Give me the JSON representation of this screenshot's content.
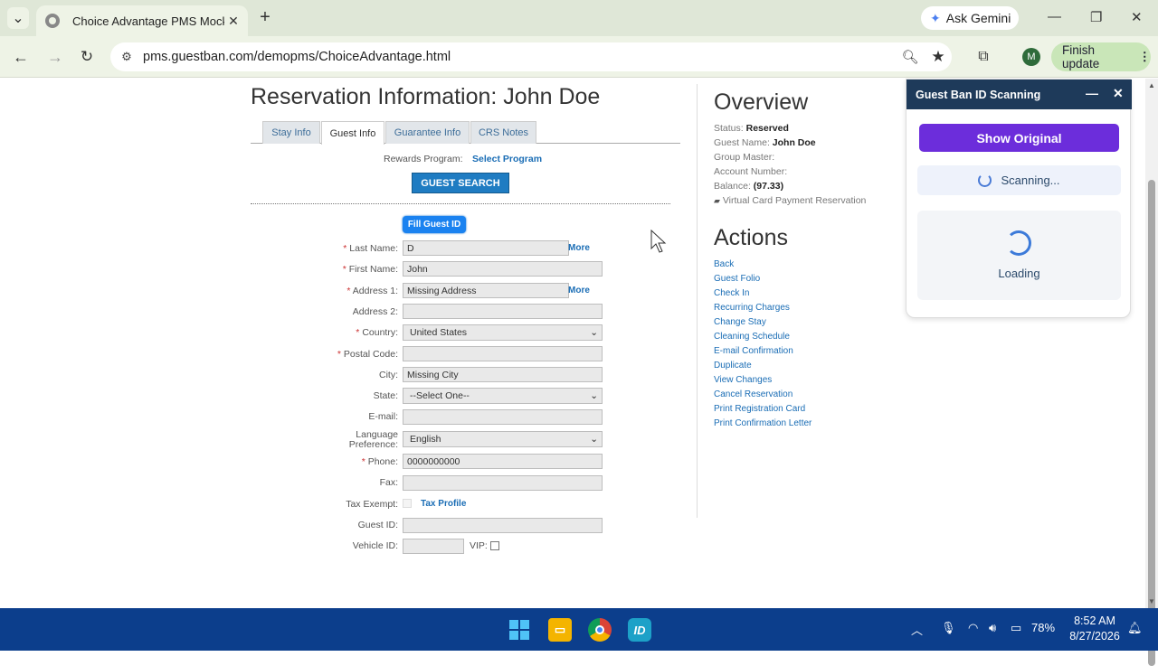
{
  "browser": {
    "tab_title": "Choice Advantage PMS Mockup",
    "url": "pms.guestban.com/demopms/ChoiceAdvantage.html",
    "gemini_label": "Ask Gemini",
    "profile_initial": "M",
    "finish_update_label": "Finish update"
  },
  "reservation": {
    "title": "Reservation Information: John Doe",
    "tabs": [
      {
        "label": "Stay Info"
      },
      {
        "label": "Guest Info"
      },
      {
        "label": "Guarantee Info"
      },
      {
        "label": "CRS Notes"
      }
    ],
    "active_tab": "Guest Info",
    "rewards_label": "Rewards Program:",
    "rewards_link": "Select Program",
    "guest_search_label": "GUEST SEARCH",
    "fill_guest_id_label": "Fill Guest ID",
    "more_label": "More",
    "fields": {
      "last_name": {
        "label": "Last Name:",
        "value": "D"
      },
      "first_name": {
        "label": "First Name:",
        "value": "John"
      },
      "address1": {
        "label": "Address 1:",
        "value": "Missing Address"
      },
      "address2": {
        "label": "Address 2:",
        "value": ""
      },
      "country": {
        "label": "Country:",
        "value": "United States"
      },
      "postal_code": {
        "label": "Postal Code:",
        "value": ""
      },
      "city": {
        "label": "City:",
        "value": "Missing City"
      },
      "state": {
        "label": "State:",
        "value": "--Select One--"
      },
      "email": {
        "label": "E-mail:",
        "value": ""
      },
      "language_line1": "Language",
      "language_line2": "Preference:",
      "language_value": "English",
      "phone": {
        "label": "Phone:",
        "value": "0000000000"
      },
      "fax": {
        "label": "Fax:",
        "value": ""
      },
      "tax_exempt": {
        "label": "Tax Exempt:",
        "link": "Tax Profile"
      },
      "guest_id": {
        "label": "Guest ID:",
        "value": ""
      },
      "vehicle_id": {
        "label": "Vehicle ID:",
        "value": ""
      },
      "vip_label": "VIP:"
    }
  },
  "overview": {
    "title": "Overview",
    "status_label": "Status:",
    "status_value": "Reserved",
    "guest_name_label": "Guest Name:",
    "guest_name_value": "John Doe",
    "group_master_label": "Group Master:",
    "account_number_label": "Account Number:",
    "balance_label": "Balance:",
    "balance_value": "(97.33)",
    "virtual_card": "Virtual Card Payment Reservation"
  },
  "actions": {
    "title": "Actions",
    "links": [
      "Back",
      "Guest Folio",
      "Check In",
      "Recurring Charges",
      "Change Stay",
      "Cleaning Schedule",
      "E-mail Confirmation",
      "Duplicate",
      "View Changes",
      "Cancel Reservation",
      "Print Registration Card",
      "Print Confirmation Letter"
    ]
  },
  "panel": {
    "title": "Guest Ban ID Scanning",
    "show_original": "Show Original",
    "scanning": "Scanning...",
    "loading": "Loading"
  },
  "taskbar": {
    "battery": "78%",
    "time": "8:52 AM",
    "date": "8/27/2026"
  }
}
